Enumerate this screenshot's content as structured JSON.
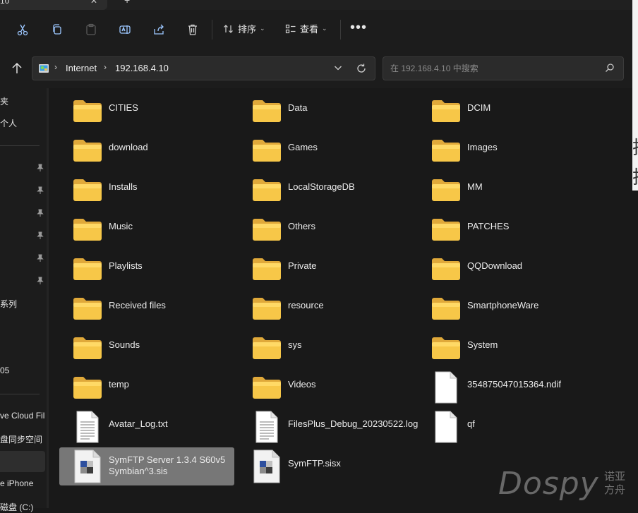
{
  "tab": {
    "title": "10",
    "close": "✕",
    "add": "+"
  },
  "background_glyphs": [
    "择",
    "择"
  ],
  "toolbar": {
    "sort_label": "排序",
    "view_label": "查看",
    "more": "•••",
    "caret": "⌄"
  },
  "address": {
    "sep": "›",
    "crumbs": [
      "Internet",
      "192.168.4.10"
    ]
  },
  "search": {
    "placeholder": "在 192.168.4.10 中搜索"
  },
  "sidebar": {
    "labels": [
      "夹",
      "个人",
      "系列",
      "05",
      "ve Cloud Fil",
      "盘同步空间",
      "e iPhone",
      "磁盘 (C:)"
    ]
  },
  "files": [
    {
      "name": "CITIES",
      "type": "folder"
    },
    {
      "name": "Data",
      "type": "folder"
    },
    {
      "name": "DCIM",
      "type": "folder"
    },
    {
      "name": "download",
      "type": "folder"
    },
    {
      "name": "Games",
      "type": "folder"
    },
    {
      "name": "Images",
      "type": "folder"
    },
    {
      "name": "Installs",
      "type": "folder"
    },
    {
      "name": "LocalStorageDB",
      "type": "folder"
    },
    {
      "name": "MM",
      "type": "folder"
    },
    {
      "name": "Music",
      "type": "folder"
    },
    {
      "name": "Others",
      "type": "folder"
    },
    {
      "name": "PATCHES",
      "type": "folder"
    },
    {
      "name": "Playlists",
      "type": "folder"
    },
    {
      "name": "Private",
      "type": "folder"
    },
    {
      "name": "QQDownload",
      "type": "folder"
    },
    {
      "name": "Received files",
      "type": "folder"
    },
    {
      "name": "resource",
      "type": "folder"
    },
    {
      "name": "SmartphoneWare",
      "type": "folder"
    },
    {
      "name": "Sounds",
      "type": "folder"
    },
    {
      "name": "sys",
      "type": "folder"
    },
    {
      "name": "System",
      "type": "folder"
    },
    {
      "name": "temp",
      "type": "folder"
    },
    {
      "name": "Videos",
      "type": "folder"
    },
    {
      "name": "354875047015364.ndif",
      "type": "blank"
    },
    {
      "name": "Avatar_Log.txt",
      "type": "text"
    },
    {
      "name": "FilesPlus_Debug_20230522.log",
      "type": "text"
    },
    {
      "name": "qf",
      "type": "blank"
    },
    {
      "name": "SymFTP Server 1.3.4 S60v5\nSymbian^3.sis",
      "type": "sis",
      "selected": true
    },
    {
      "name": "SymFTP.sisx",
      "type": "sis"
    }
  ],
  "watermark": {
    "brand": "Dospy",
    "sub1": "诺亚",
    "sub2": "方舟"
  },
  "colors": {
    "folder": "#f5c34a",
    "folder_light": "#ffd966",
    "selected": "#777777",
    "bg": "#191919"
  }
}
